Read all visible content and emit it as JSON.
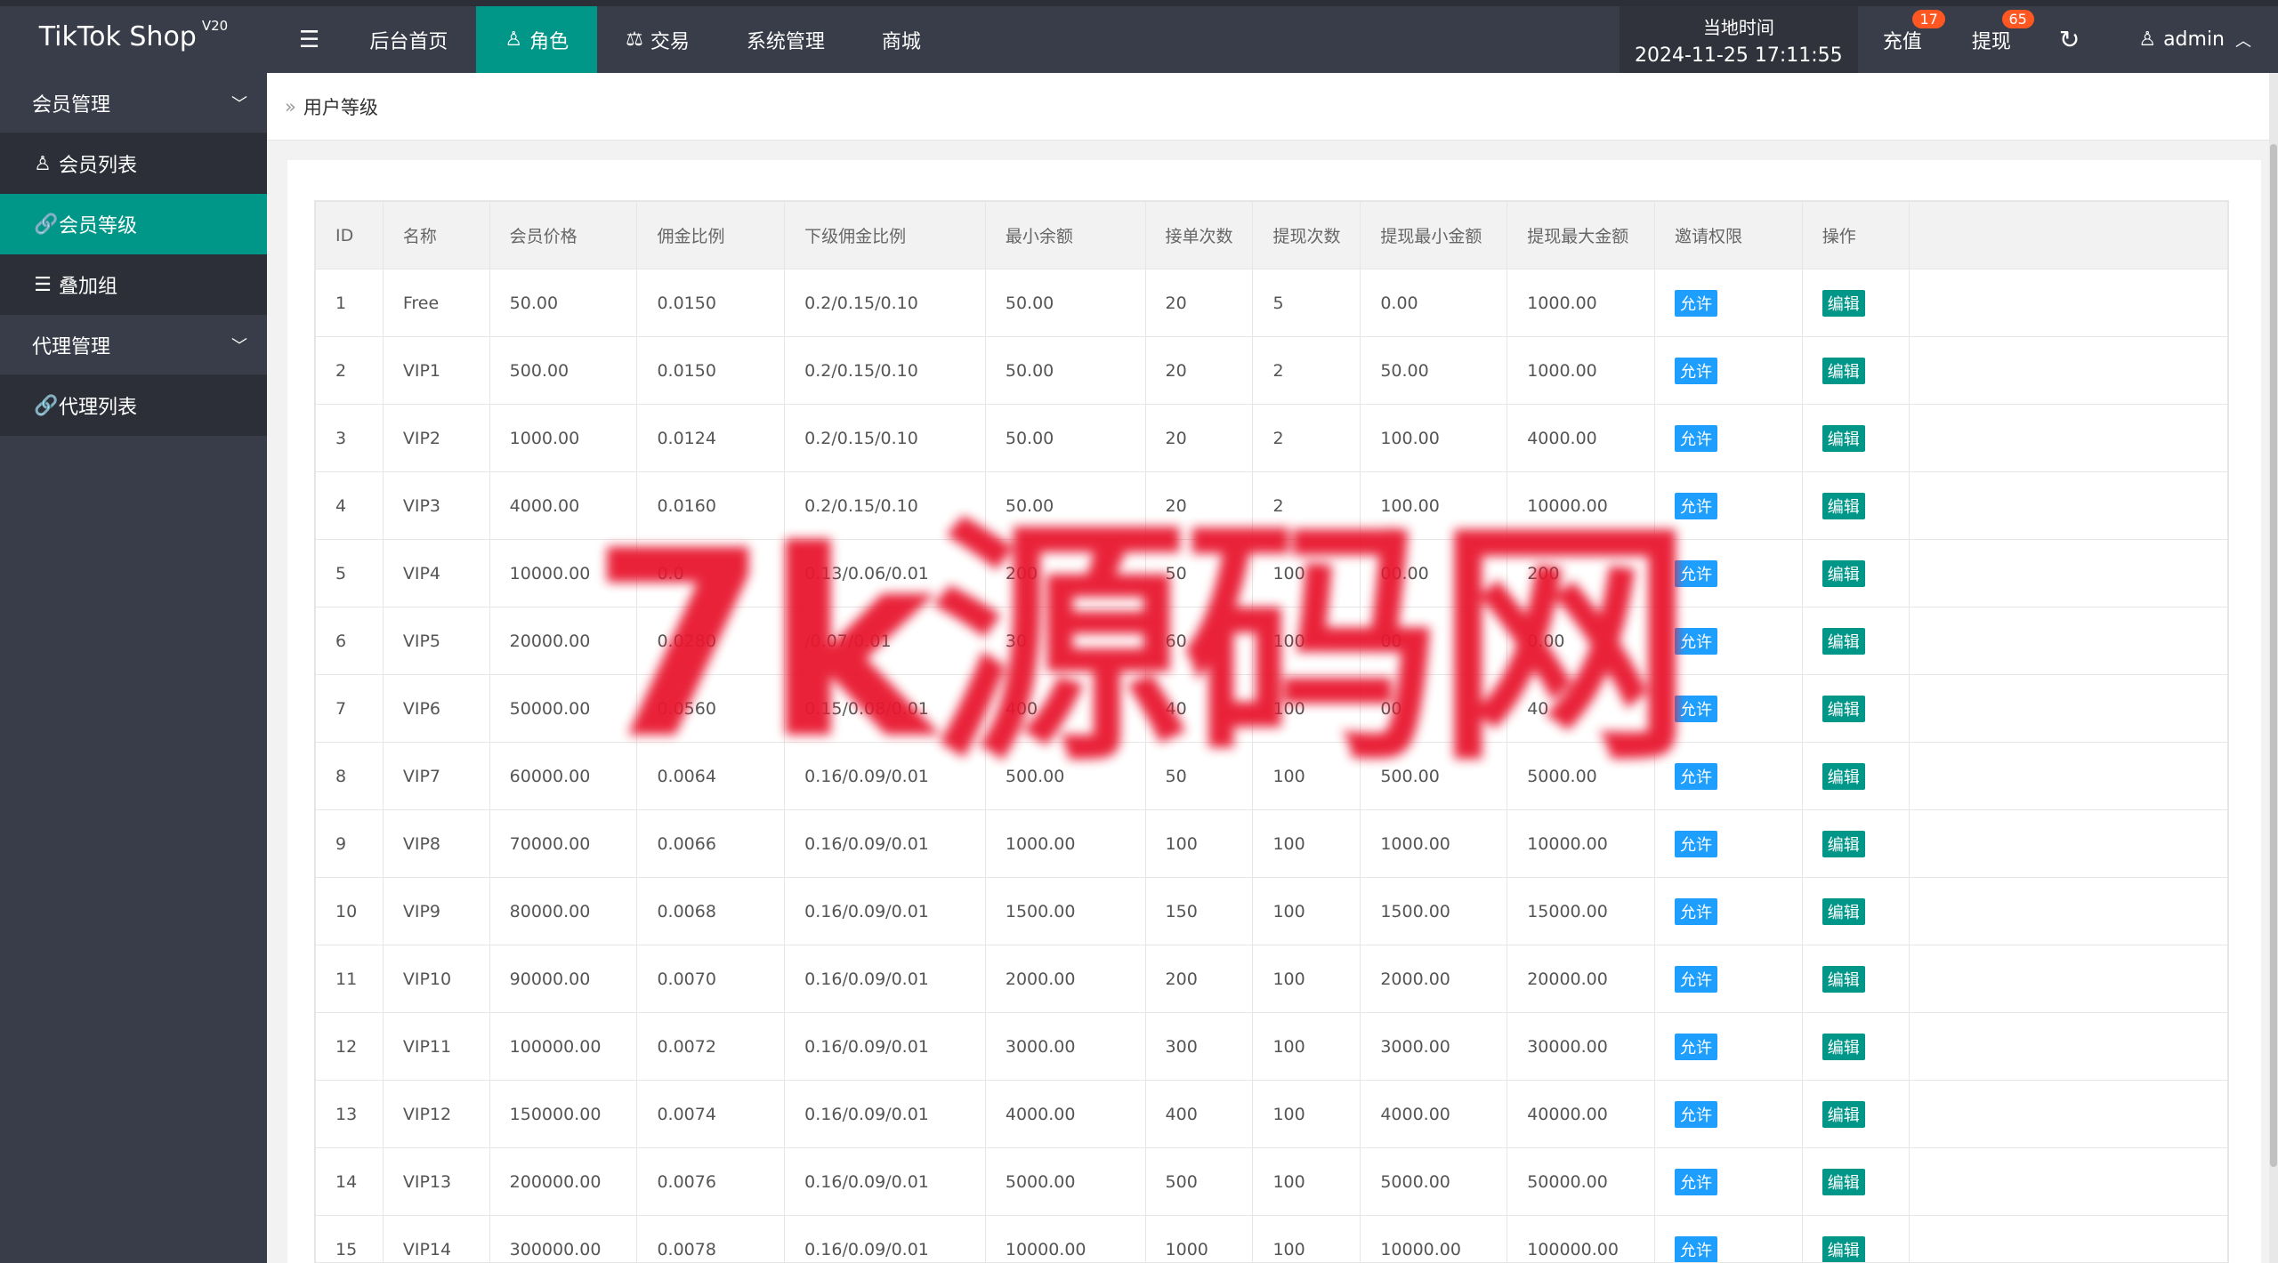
{
  "app": {
    "name": "TikTok Shop",
    "version": "V20"
  },
  "topnav": {
    "menu_icon": "☰",
    "items": [
      {
        "label": "后台首页",
        "icon": ""
      },
      {
        "label": "角色",
        "icon": "♙"
      },
      {
        "label": "交易",
        "icon": "⚖"
      },
      {
        "label": "系统管理",
        "icon": ""
      },
      {
        "label": "商城",
        "icon": ""
      }
    ],
    "active_index": 1
  },
  "header": {
    "time_label": "当地时间",
    "time_value": "2024-11-25 17:11:55",
    "recharge_label": "充值",
    "recharge_badge": "17",
    "withdraw_label": "提现",
    "withdraw_badge": "65",
    "refresh_icon": "↻",
    "user_icon": "♙",
    "user_name": "admin",
    "user_chevron": "︿"
  },
  "sidebar": {
    "groups": [
      {
        "label": "会员管理",
        "chevron": "﹀"
      },
      {
        "label": "代理管理",
        "chevron": "﹀"
      }
    ],
    "items": [
      {
        "label": "会员列表",
        "icon": "♙"
      },
      {
        "label": "会员等级",
        "icon": "🔗"
      },
      {
        "label": "叠加组",
        "icon": "☰"
      },
      {
        "label": "代理列表",
        "icon": "🔗"
      }
    ],
    "active_item": "会员等级"
  },
  "breadcrumb": {
    "sep": "»",
    "current": "用户等级"
  },
  "table": {
    "columns": [
      "ID",
      "名称",
      "会员价格",
      "佣金比例",
      "下级佣金比例",
      "最小余额",
      "接单次数",
      "提现次数",
      "提现最小金额",
      "提现最大金额",
      "邀请权限",
      "操作"
    ],
    "allow_label": "允许",
    "edit_label": "编辑",
    "rows": [
      [
        "1",
        "Free",
        "50.00",
        "0.0150",
        "0.2/0.15/0.10",
        "50.00",
        "20",
        "5",
        "0.00",
        "1000.00"
      ],
      [
        "2",
        "VIP1",
        "500.00",
        "0.0150",
        "0.2/0.15/0.10",
        "50.00",
        "20",
        "2",
        "50.00",
        "1000.00"
      ],
      [
        "3",
        "VIP2",
        "1000.00",
        "0.0124",
        "0.2/0.15/0.10",
        "50.00",
        "20",
        "2",
        "100.00",
        "4000.00"
      ],
      [
        "4",
        "VIP3",
        "4000.00",
        "0.0160",
        "0.2/0.15/0.10",
        "50.00",
        "20",
        "2",
        "100.00",
        "10000.00"
      ],
      [
        "5",
        "VIP4",
        "10000.00",
        "0.0",
        "0.13/0.06/0.01",
        "200",
        "50",
        "100",
        "00.00",
        "200"
      ],
      [
        "6",
        "VIP5",
        "20000.00",
        "0.0280",
        "/0.07/0.01",
        "30",
        "60",
        "100",
        "00",
        "0.00"
      ],
      [
        "7",
        "VIP6",
        "50000.00",
        "0.0560",
        "0.15/0.08/0.01",
        "400",
        "40",
        "100",
        "00",
        "40"
      ],
      [
        "8",
        "VIP7",
        "60000.00",
        "0.0064",
        "0.16/0.09/0.01",
        "500.00",
        "50",
        "100",
        "500.00",
        "5000.00"
      ],
      [
        "9",
        "VIP8",
        "70000.00",
        "0.0066",
        "0.16/0.09/0.01",
        "1000.00",
        "100",
        "100",
        "1000.00",
        "10000.00"
      ],
      [
        "10",
        "VIP9",
        "80000.00",
        "0.0068",
        "0.16/0.09/0.01",
        "1500.00",
        "150",
        "100",
        "1500.00",
        "15000.00"
      ],
      [
        "11",
        "VIP10",
        "90000.00",
        "0.0070",
        "0.16/0.09/0.01",
        "2000.00",
        "200",
        "100",
        "2000.00",
        "20000.00"
      ],
      [
        "12",
        "VIP11",
        "100000.00",
        "0.0072",
        "0.16/0.09/0.01",
        "3000.00",
        "300",
        "100",
        "3000.00",
        "30000.00"
      ],
      [
        "13",
        "VIP12",
        "150000.00",
        "0.0074",
        "0.16/0.09/0.01",
        "4000.00",
        "400",
        "100",
        "4000.00",
        "40000.00"
      ],
      [
        "14",
        "VIP13",
        "200000.00",
        "0.0076",
        "0.16/0.09/0.01",
        "5000.00",
        "500",
        "100",
        "5000.00",
        "50000.00"
      ],
      [
        "15",
        "VIP14",
        "300000.00",
        "0.0078",
        "0.16/0.09/0.01",
        "10000.00",
        "1000",
        "100",
        "10000.00",
        "100000.00"
      ]
    ]
  },
  "watermark": {
    "text": "7k源码网",
    "color": "#e8172f"
  },
  "colors": {
    "primary": "#009688",
    "dark": "#393d49",
    "blue": "#1e9fff",
    "badge": "#ff5722"
  }
}
